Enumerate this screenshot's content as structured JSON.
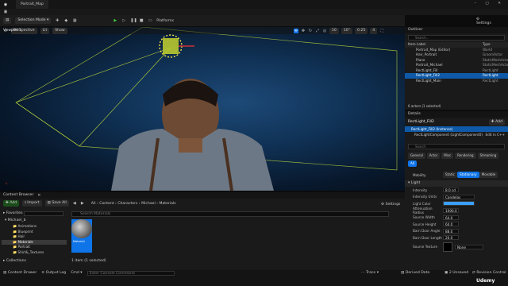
{
  "title": {
    "tab": "Portrait_Map"
  },
  "toolbar": {
    "mode": "Selection Mode",
    "platforms": "Platforms",
    "settings": "Settings"
  },
  "viewport": {
    "tab": "Viewport 1",
    "perspective": "Perspective",
    "lit": "Lit",
    "show": "Show",
    "fov": "90",
    "snap": "10",
    "angle": "10°",
    "scale": "0.25",
    "cam": "4"
  },
  "content_browser": {
    "tab": "Content Browser",
    "add": "Add",
    "import": "Import",
    "save_all": "Save All",
    "path": [
      "All",
      "Content",
      "Characters",
      "Michael",
      "Materials"
    ],
    "settings": "Settings",
    "search_placeholder": "Search Materials",
    "favorites": "Favorites",
    "root": "Michael_b",
    "folders": [
      "Animations",
      "Blueprint",
      "Hair",
      "Materials",
      "Portrait",
      "Shirt&_Textures",
      "Sweatshirt_Mesh"
    ],
    "selected_folder": "Materials",
    "asset": "Material",
    "count": "1 item (1 selected)",
    "collections": "Collections"
  },
  "outliner": {
    "tab": "Outliner",
    "search_placeholder": "Search...",
    "col_label": "Item Label",
    "col_type": "Type",
    "rows": [
      {
        "label": "Portrait_Map (Editor)",
        "type": "World"
      },
      {
        "label": "Hair_Portrait",
        "type": "GroomActor"
      },
      {
        "label": "Plane",
        "type": "StaticMeshActor"
      },
      {
        "label": "Portrait_Michael",
        "type": "StaticMeshActor"
      },
      {
        "label": "RectLight_Fill",
        "type": "RectLight"
      },
      {
        "label": "RectLight_Fill2",
        "type": "RectLight"
      },
      {
        "label": "RectLight_Main",
        "type": "RectLight"
      }
    ],
    "selected_row": "RectLight_Fill2",
    "count": "6 actors (1 selected)"
  },
  "details": {
    "tab": "Details",
    "name": "RectLight_Fill2",
    "add": "Add",
    "instance": "RectLight_Fill2 (Instance)",
    "component": "RectLightComponent (LightComponent0)",
    "edit": "Edit in C++",
    "search_placeholder": "Search",
    "filters": [
      "General",
      "Actor",
      "Misc",
      "Rendering",
      "Streaming",
      "All"
    ],
    "selected_filter": "All",
    "mobility_label": "Mobility",
    "mobility": [
      "Static",
      "Stationary",
      "Movable"
    ],
    "mobility_selected": "Stationary",
    "section": "Light",
    "props": [
      {
        "k": "Intensity",
        "v": "8.0 cd"
      },
      {
        "k": "Intensity Units",
        "v": "Candelas"
      },
      {
        "k": "Light Color",
        "v": ""
      },
      {
        "k": "Attenuation Radius",
        "v": "1000.0"
      },
      {
        "k": "Source Width",
        "v": "64.0"
      },
      {
        "k": "Source Height",
        "v": "64.0"
      },
      {
        "k": "Barn Door Angle",
        "v": "88.0"
      },
      {
        "k": "Barn Door Length",
        "v": "20.0"
      }
    ],
    "source_texture_label": "Source Texture",
    "source_texture": "None"
  },
  "status": {
    "drawer": "Content Drawer",
    "output": "Output Log",
    "cmd": "Cmd",
    "cmd_placeholder": "Enter Console Command",
    "trace": "Trace",
    "derived": "Derived Data",
    "unsaved": "2 Unsaved",
    "revision": "Revision Control"
  },
  "colors": {
    "accent": "#0f74e8",
    "light_color": "#3aa0ff"
  }
}
